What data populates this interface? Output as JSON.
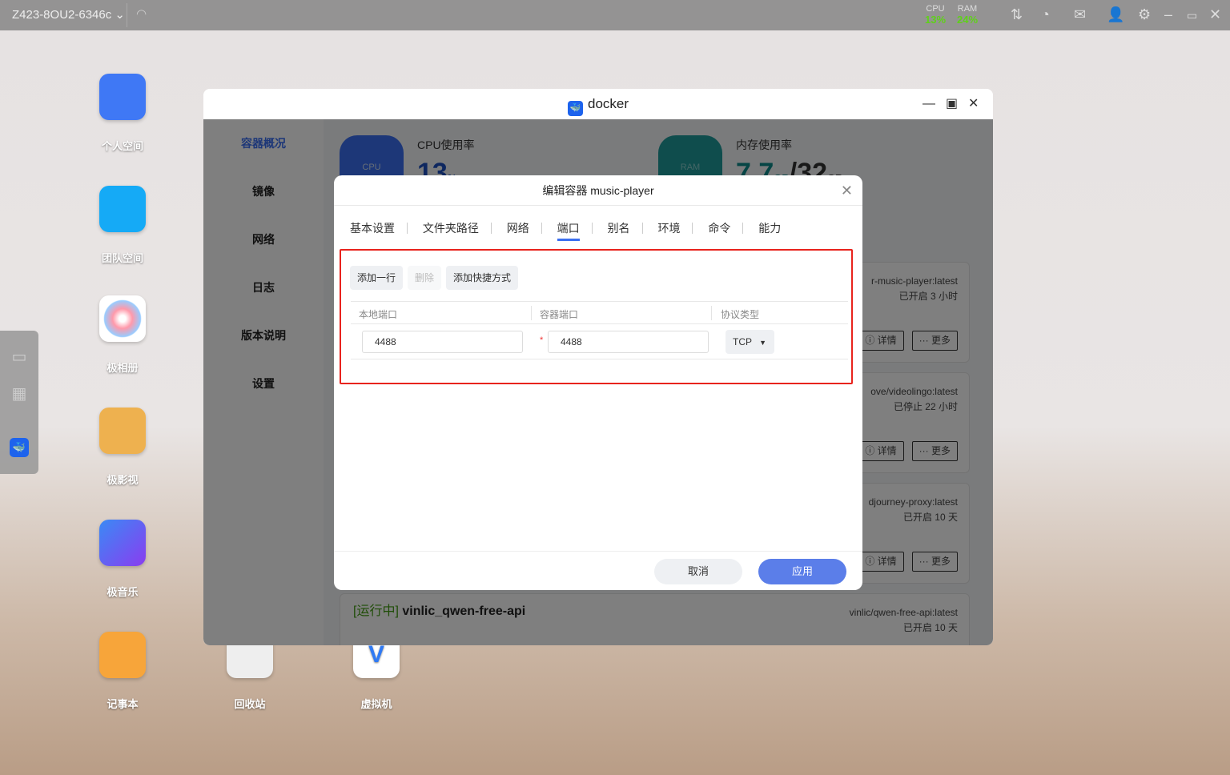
{
  "topbar": {
    "host": "Z423-8OU2-6346c",
    "cpu_label": "CPU",
    "cpu_value": "13%",
    "ram_label": "RAM",
    "ram_value": "24%"
  },
  "desktop": {
    "apps": [
      {
        "label": "个人空间"
      },
      {
        "label": "团队空间"
      },
      {
        "label": "极相册"
      },
      {
        "label": "极影视"
      },
      {
        "label": "极音乐"
      },
      {
        "label": "记事本"
      },
      {
        "label": "回收站"
      },
      {
        "label": "虚拟机"
      }
    ]
  },
  "window": {
    "title": "docker",
    "sidebar": [
      {
        "label": "容器概况",
        "active": true
      },
      {
        "label": "镜像"
      },
      {
        "label": "网络"
      },
      {
        "label": "日志"
      },
      {
        "label": "版本说明"
      },
      {
        "label": "设置"
      }
    ],
    "cpu": {
      "label": "CPU使用率",
      "value": "13",
      "unit": "%",
      "icon_text": "CPU"
    },
    "mem": {
      "label": "内存使用率",
      "used": "7.7",
      "used_unit": "GB",
      "total": "/32",
      "total_unit": "GB",
      "icon_text": "RAM"
    },
    "containers": [
      {
        "image": "r-music-player:latest",
        "status": "已开启 3 小时"
      },
      {
        "image": "ove/videolingo:latest",
        "status": "已停止 22 小时"
      },
      {
        "image": "djourney-proxy:latest",
        "status": "已开启 10 天"
      },
      {
        "image": "vinlic/qwen-free-api:latest",
        "status": "已开启 10 天",
        "state": "[运行中]",
        "name": "vinlic_qwen-free-api"
      }
    ],
    "detail_label": "ⓘ 详情",
    "more_label": "··· 更多"
  },
  "modal": {
    "title": "编辑容器 music-player",
    "tabs": [
      "基本设置",
      "文件夹路径",
      "网络",
      "端口",
      "别名",
      "环境",
      "命令",
      "能力"
    ],
    "active_tab": "端口",
    "add_row": "添加一行",
    "delete": "删除",
    "add_shortcut": "添加快捷方式",
    "columns": [
      "本地端口",
      "容器端口",
      "协议类型"
    ],
    "rows": [
      {
        "local": "4488",
        "container": "4488",
        "protocol": "TCP"
      }
    ],
    "cancel": "取消",
    "apply": "应用"
  },
  "colors": {
    "accent": "#3b6ff0",
    "apply": "#5b7ee9",
    "highlight": "#e8231d",
    "running": "#3f9a0f"
  }
}
